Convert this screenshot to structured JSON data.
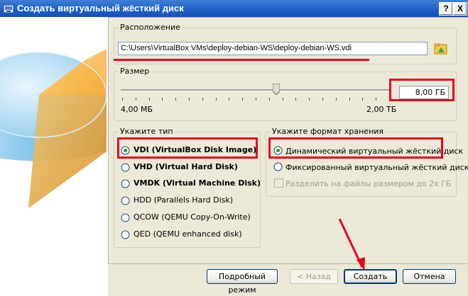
{
  "window": {
    "title": "Создать виртуальный жёсткий диск",
    "help_label": "?",
    "close_label": "X"
  },
  "location": {
    "legend": "Расположение",
    "path": "C:\\Users\\VirtualBox VMs\\deploy-debian-WS\\deploy-debian-WS.vdi"
  },
  "size": {
    "legend": "Размер",
    "value": "8,00 ГБ",
    "min_label": "4,00 МБ",
    "max_label": "2,00 ТБ",
    "level_fraction": 0.58
  },
  "type": {
    "legend": "Укажите тип",
    "options": [
      {
        "label": "VDI (VirtualBox Disk Image)",
        "selected": true
      },
      {
        "label": "VHD (Virtual Hard Disk)",
        "selected": false
      },
      {
        "label": "VMDK (Virtual Machine Disk)",
        "selected": false
      },
      {
        "label": "HDD (Parallels Hard Disk)",
        "selected": false
      },
      {
        "label": "QCOW (QEMU Copy-On-Write)",
        "selected": false
      },
      {
        "label": "QED (QEMU enhanced disk)",
        "selected": false
      }
    ]
  },
  "storage": {
    "legend": "Укажите формат хранения",
    "dynamic_label": "Динамический виртуальный жёсткий диск",
    "fixed_label": "Фиксированный виртуальный жёсткий диск",
    "split_label": "Разделить на файлы размером до 2х ГБ",
    "dynamic_selected": true
  },
  "buttons": {
    "expert": "Подробный режим",
    "back": "< Назад",
    "create": "Создать",
    "cancel": "Отмена"
  },
  "colors": {
    "highlight": "#e8001f",
    "title_bar": "#1d5fc4",
    "window_bg": "#ece9d8"
  }
}
